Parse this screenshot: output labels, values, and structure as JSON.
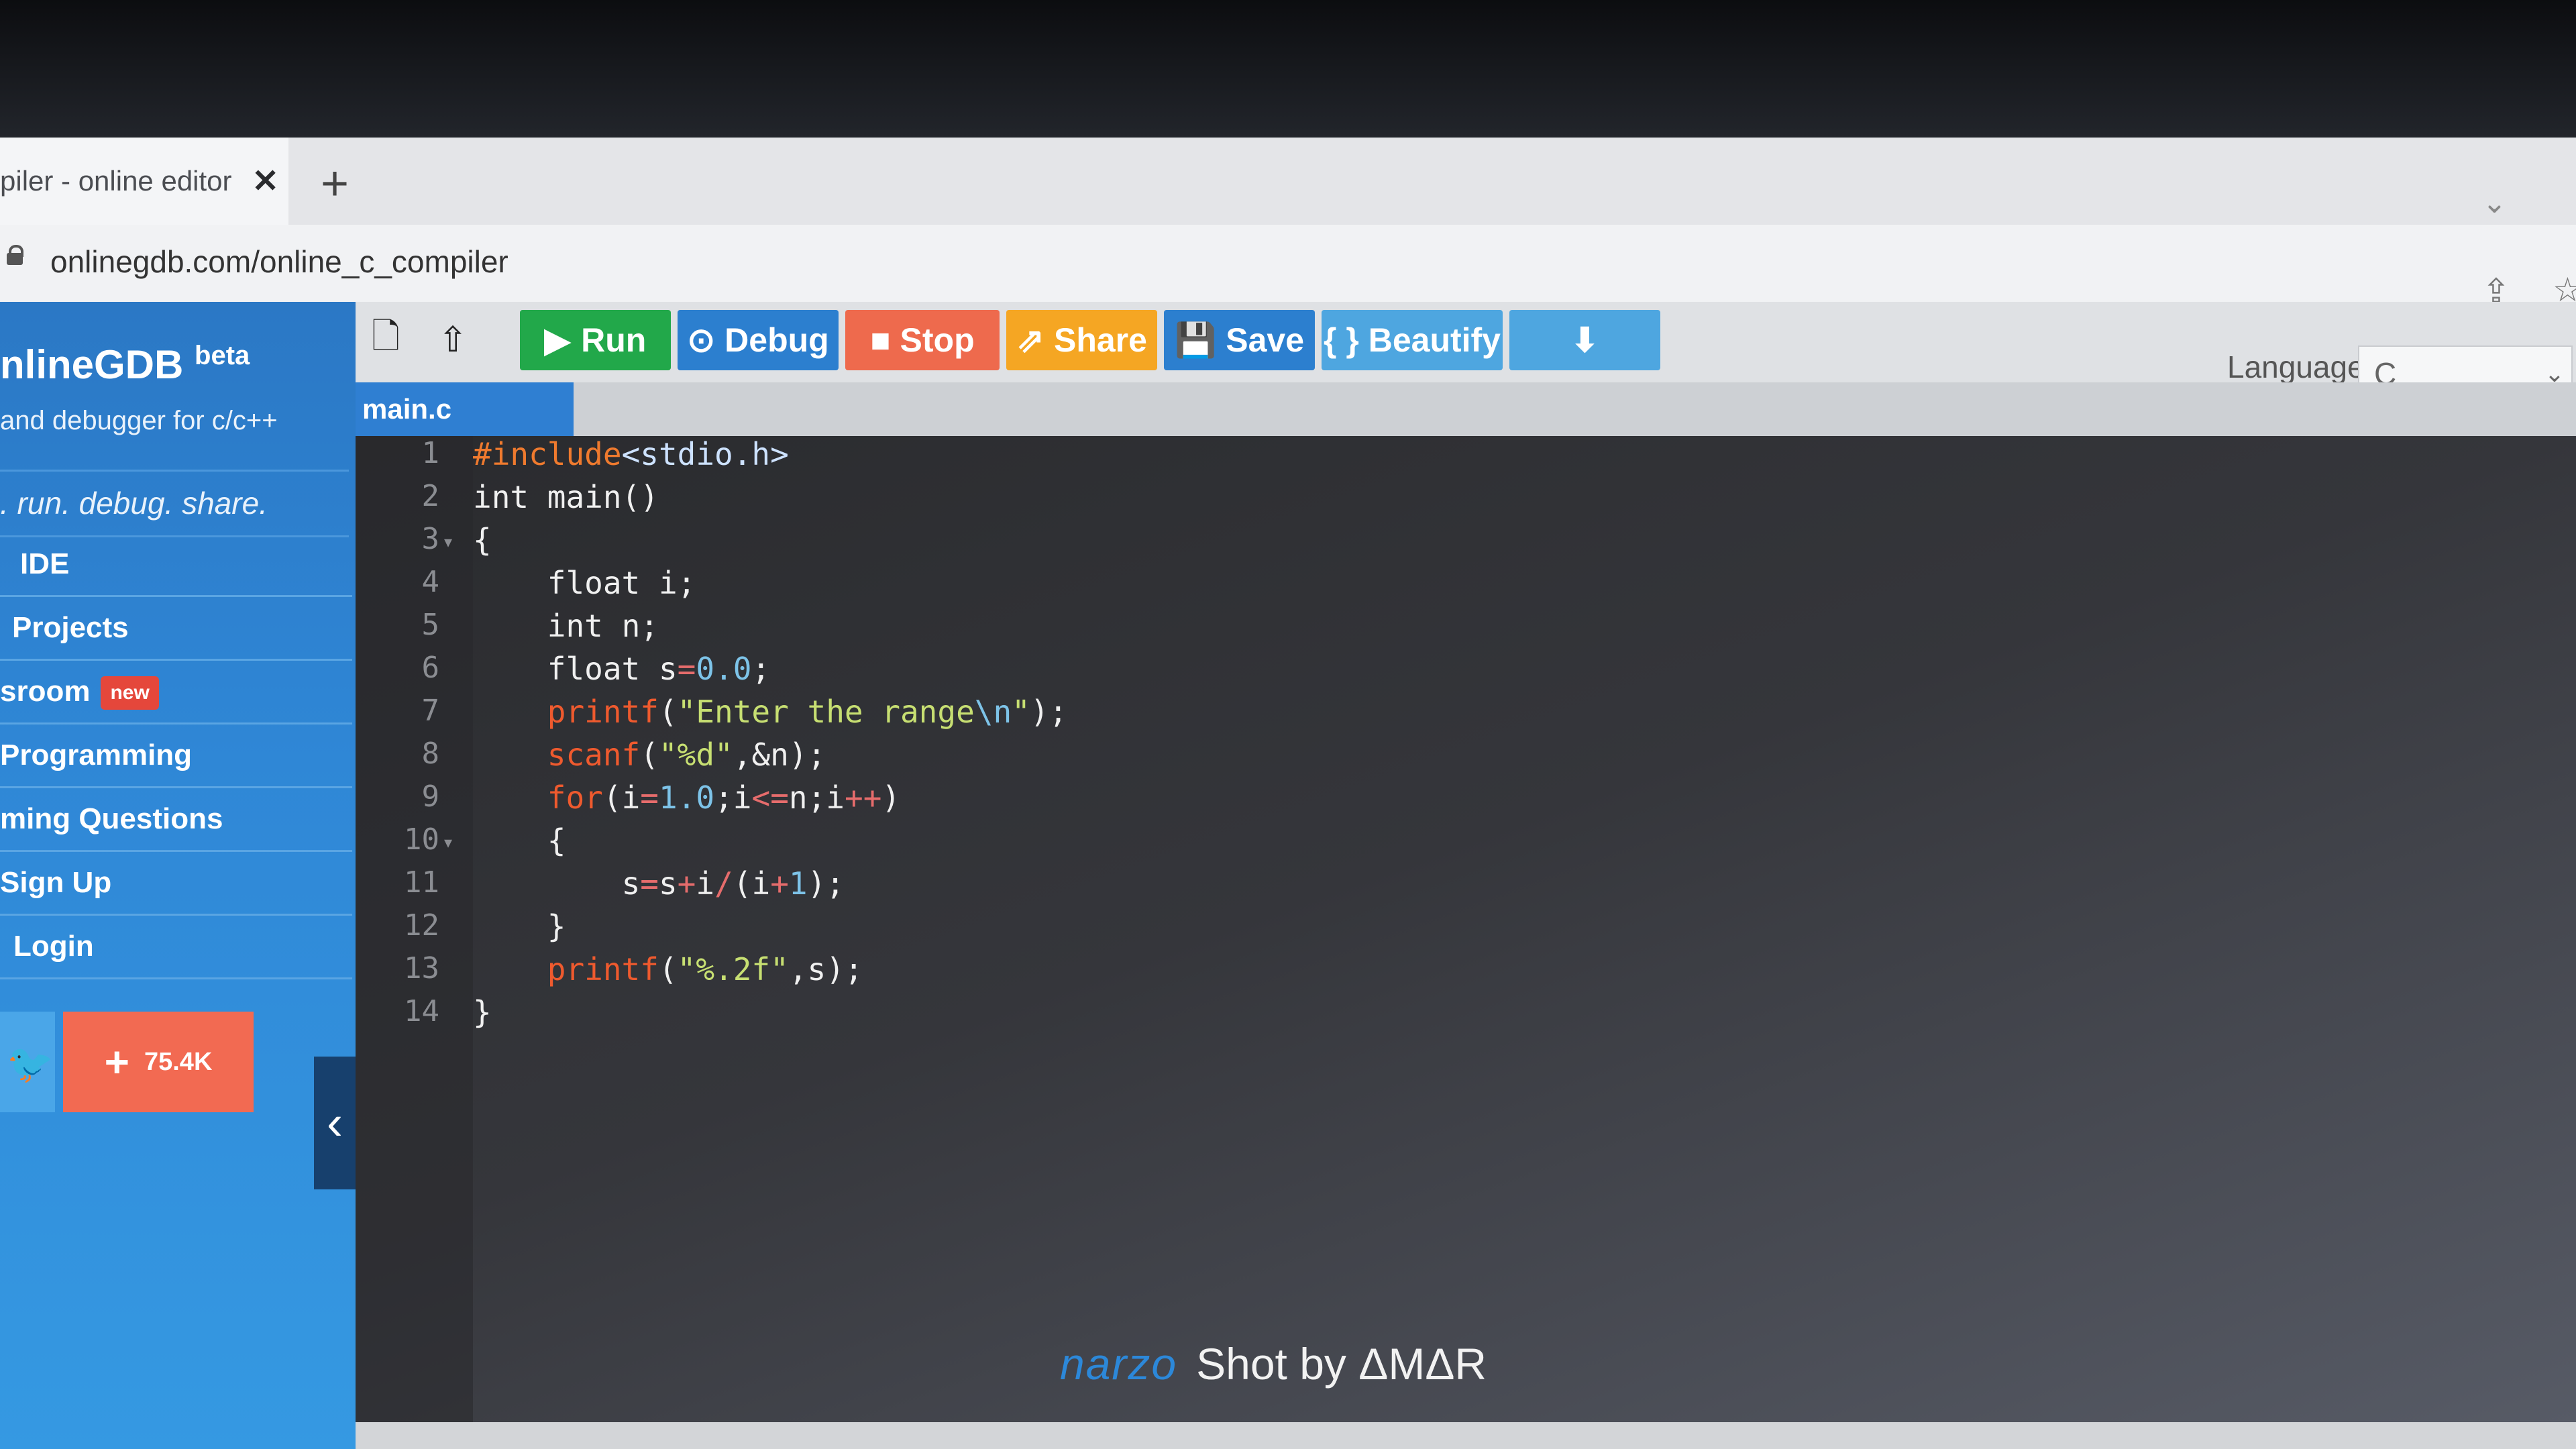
{
  "browser": {
    "tab_title": "piler - online editor",
    "tab_close": "✕",
    "new_tab": "+",
    "url": "onlinegdb.com/online_c_compiler"
  },
  "sidebar": {
    "brand": "nlineGDB",
    "brand_beta": "beta",
    "tagline": "and debugger for c/c++",
    "motto": ". run. debug. share.",
    "items": [
      {
        "label": "IDE"
      },
      {
        "label": "Projects"
      },
      {
        "label": "sroom",
        "badge": "new"
      },
      {
        "label": "Programming"
      },
      {
        "label": "ming Questions"
      },
      {
        "label": "Sign Up"
      },
      {
        "label": "Login"
      }
    ],
    "follow_count": "75.4K",
    "collapse": "‹"
  },
  "toolbar": {
    "run": "Run",
    "debug": "Debug",
    "stop": "Stop",
    "share": "Share",
    "save": "Save",
    "beautify": "{ } Beautify",
    "language_label": "Language",
    "language_value": "C",
    "colors": {
      "run": "#22a84a",
      "debug": "#2c7fcf",
      "stop": "#ee6a4d",
      "share": "#f5a623",
      "save": "#2c7fcf",
      "beautify": "#4ea6e0",
      "download": "#4ea6e0"
    }
  },
  "editor": {
    "file_tab": "main.c",
    "line_numbers": [
      "1",
      "2",
      "3",
      "4",
      "5",
      "6",
      "7",
      "8",
      "9",
      "10",
      "11",
      "12",
      "13",
      "14"
    ],
    "code": [
      "#include<stdio.h>",
      "int main()",
      "{",
      "    float i;",
      "    int n;",
      "    float s=0.0;",
      "    printf(\"Enter the range\\n\");",
      "    scanf(\"%d\",&n);",
      "    for(i=1.0;i<=n;i++)",
      "    {",
      "        s=s+i/(i+1);",
      "    }",
      "    printf(\"%.2f\",s);",
      "}"
    ]
  },
  "watermark": {
    "brand": "narzo",
    "text": "Shot by ΔMΔR"
  }
}
